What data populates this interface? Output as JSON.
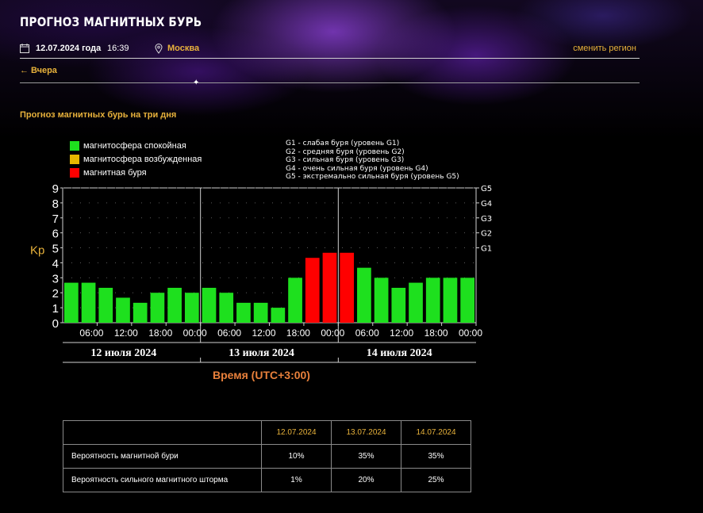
{
  "header": {
    "title": "ПРОГНОЗ МАГНИТНЫХ БУРЬ",
    "date": "12.07.2024 года",
    "time": "16:39",
    "city": "Москва",
    "change_region": "сменить регион",
    "yesterday": "← Вчера"
  },
  "subtitle": "Прогноз магнитных бурь на три дня",
  "legend": [
    {
      "label": "магнитосфера спокойная",
      "color": "#1ee01e"
    },
    {
      "label": "магнитосфера возбужденная",
      "color": "#e6b800"
    },
    {
      "label": "магнитная буря",
      "color": "#ff0000"
    }
  ],
  "g_legend": [
    "G1 - слабая буря (уровень G1)",
    "G2 - средняя буря (уровень G2)",
    "G3 - сильная буря (уровень G3)",
    "G4 - очень сильная буря (уровень G4)",
    "G5 - экстремально сильная буря (уровень G5)"
  ],
  "chart_data": {
    "type": "bar",
    "ylabel": "Kp",
    "xlabel": "Время (UTC+3:00)",
    "ylim": [
      0,
      9
    ],
    "yticks": [
      "0",
      "1",
      "2",
      "3",
      "4",
      "5",
      "6",
      "7",
      "8",
      "9"
    ],
    "g_ticks": [
      {
        "label": "G1",
        "kp": 5
      },
      {
        "label": "G2",
        "kp": 6
      },
      {
        "label": "G3",
        "kp": 7
      },
      {
        "label": "G4",
        "kp": 8
      },
      {
        "label": "G5",
        "kp": 9
      }
    ],
    "x_ticks": [
      "06:00",
      "12:00",
      "18:00",
      "00:00",
      "06:00",
      "12:00",
      "18:00",
      "00:00",
      "06:00",
      "12:00",
      "18:00",
      "00:00"
    ],
    "days": [
      "12 июля 2024",
      "13 июля 2024",
      "14 июля 2024"
    ],
    "values": [
      2.67,
      2.67,
      2.33,
      1.67,
      1.33,
      2.0,
      2.33,
      2.0,
      2.33,
      2.0,
      1.33,
      1.33,
      1.0,
      3.0,
      4.33,
      4.67,
      4.67,
      3.67,
      3.0,
      2.33,
      2.67,
      3.0,
      3.0,
      3.0
    ],
    "colors": [
      "#1ee01e",
      "#1ee01e",
      "#1ee01e",
      "#1ee01e",
      "#1ee01e",
      "#1ee01e",
      "#1ee01e",
      "#1ee01e",
      "#1ee01e",
      "#1ee01e",
      "#1ee01e",
      "#1ee01e",
      "#1ee01e",
      "#1ee01e",
      "#ff0000",
      "#ff0000",
      "#ff0000",
      "#1ee01e",
      "#1ee01e",
      "#1ee01e",
      "#1ee01e",
      "#1ee01e",
      "#1ee01e",
      "#1ee01e"
    ]
  },
  "table": {
    "headers": [
      "",
      "12.07.2024",
      "13.07.2024",
      "14.07.2024"
    ],
    "rows": [
      {
        "label": "Вероятность магнитной бури",
        "values": [
          "10%",
          "35%",
          "35%"
        ]
      },
      {
        "label": "Вероятность сильного магнитного шторма",
        "values": [
          "1%",
          "20%",
          "25%"
        ]
      }
    ]
  }
}
